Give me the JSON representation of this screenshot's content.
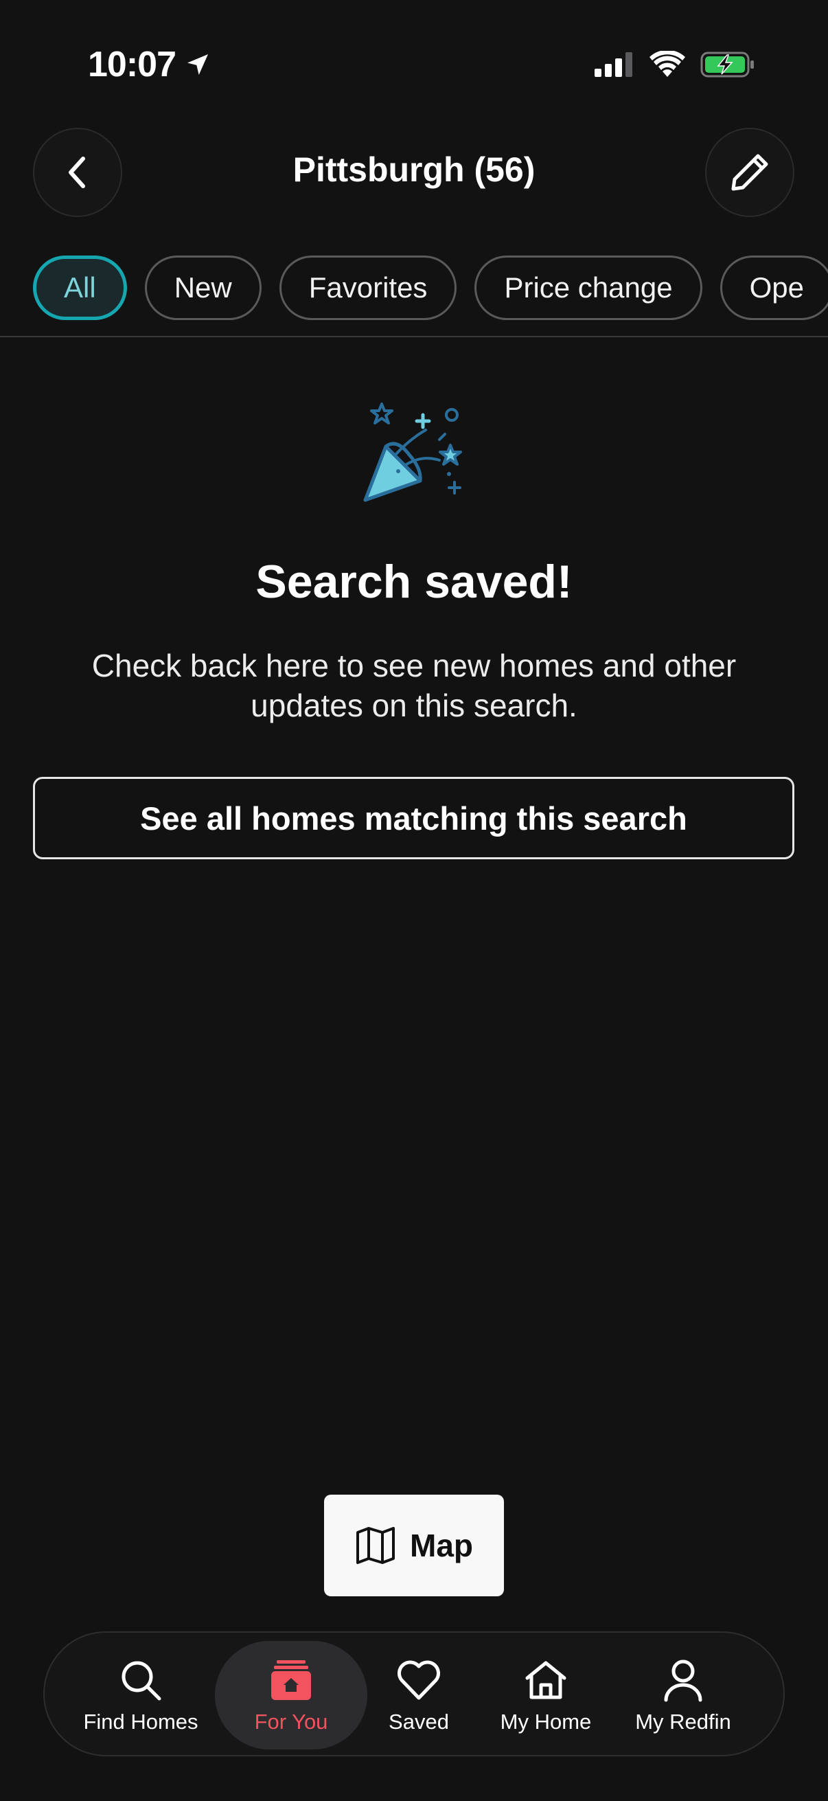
{
  "status_bar": {
    "time": "10:07",
    "icons": [
      "location-arrow-icon",
      "cellular-signal-icon",
      "wifi-icon",
      "battery-charging-icon"
    ]
  },
  "header": {
    "title": "Pittsburgh (56)",
    "back_icon": "chevron-left-icon",
    "edit_icon": "pencil-icon"
  },
  "filters": {
    "items": [
      {
        "label": "All",
        "active": true
      },
      {
        "label": "New",
        "active": false
      },
      {
        "label": "Favorites",
        "active": false
      },
      {
        "label": "Price change",
        "active": false
      },
      {
        "label": "Ope",
        "active": false
      }
    ]
  },
  "empty_state": {
    "icon": "party-popper-icon",
    "headline": "Search saved!",
    "message": "Check back here to see new homes and other updates on this search.",
    "button_label": "See all homes matching this search"
  },
  "map_button": {
    "label": "Map",
    "icon": "map-icon"
  },
  "bottom_nav": {
    "items": [
      {
        "label": "Find Homes",
        "icon": "search-icon",
        "active": false
      },
      {
        "label": "For You",
        "icon": "for-you-house-icon",
        "active": true
      },
      {
        "label": "Saved",
        "icon": "heart-icon",
        "active": false
      },
      {
        "label": "My Home",
        "icon": "home-icon",
        "active": false
      },
      {
        "label": "My Redfin",
        "icon": "user-icon",
        "active": false
      }
    ]
  },
  "colors": {
    "background": "#121213",
    "accent_teal": "#16a6b0",
    "active_nav": "#f2535e",
    "battery_green": "#34c759"
  }
}
